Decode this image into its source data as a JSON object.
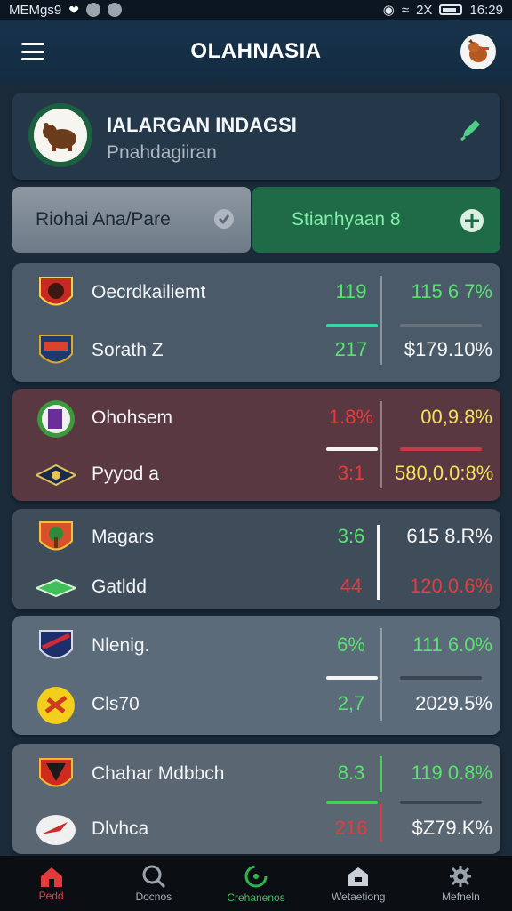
{
  "status_bar": {
    "left_text": "MEMgs9",
    "time": "16:29",
    "signal_text": "2X"
  },
  "header": {
    "title": "OLAHNASIA"
  },
  "profile": {
    "title": "IALARGAN INDAGSI",
    "subtitle": "Pnahdagiiran"
  },
  "buttons": {
    "left": "Riohai Ana/Pare",
    "right": "Stianhyaan 8"
  },
  "matches": [
    {
      "home": {
        "name": "Oecrdkailiemt",
        "score": "119",
        "pct": "115 6 7%"
      },
      "away": {
        "name": "Sorath Z",
        "score": "217",
        "pct": "$179.10%"
      }
    },
    {
      "home": {
        "name": "Ohohsem",
        "score": "1.8%",
        "pct": "00,9.8%"
      },
      "away": {
        "name": "Pyyod a",
        "score": "3:1",
        "pct": "580,0.0:8%"
      }
    },
    {
      "home": {
        "name": "Magars",
        "score": "3:6",
        "pct": "615 8.R%"
      },
      "away": {
        "name": "Gatldd",
        "score": "44",
        "pct": "120.0.6%"
      }
    },
    {
      "home": {
        "name": "Nlenig.",
        "score": "6%",
        "pct": "111 6.0%"
      },
      "away": {
        "name": "Cls70",
        "score": "2,7",
        "pct": "2029.5%"
      }
    },
    {
      "home": {
        "name": "Chahar Mdbbch",
        "score": "8.3",
        "pct": "119 0.8%"
      },
      "away": {
        "name": "Dlvhca",
        "score": "216",
        "pct": "$Z79.K%"
      }
    }
  ],
  "tabs": [
    {
      "label": "Pedd",
      "icon": "home-icon"
    },
    {
      "label": "Docnos",
      "icon": "search-icon"
    },
    {
      "label": "Crehanenos",
      "icon": "live-icon"
    },
    {
      "label": "Wetaetiong",
      "icon": "stadium-icon"
    },
    {
      "label": "Mefneln",
      "icon": "settings-icon"
    }
  ],
  "colors": {
    "accent_green": "#57e36f",
    "accent_red": "#e83a3a",
    "accent_yellow": "#f3e25a",
    "header_bg": "#16324a"
  }
}
